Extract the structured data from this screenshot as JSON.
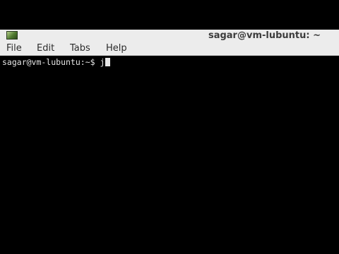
{
  "window": {
    "title": "sagar@vm-lubuntu: ~",
    "icon": "terminal-app-icon"
  },
  "menubar": {
    "items": [
      {
        "label": "File"
      },
      {
        "label": "Edit"
      },
      {
        "label": "Tabs"
      },
      {
        "label": "Help"
      }
    ]
  },
  "terminal": {
    "prompt": "sagar@vm-lubuntu:~$ ",
    "input": "j"
  },
  "colors": {
    "titlebar_bg": "#ececec",
    "terminal_bg": "#000000",
    "terminal_fg": "#e6e6e6"
  }
}
